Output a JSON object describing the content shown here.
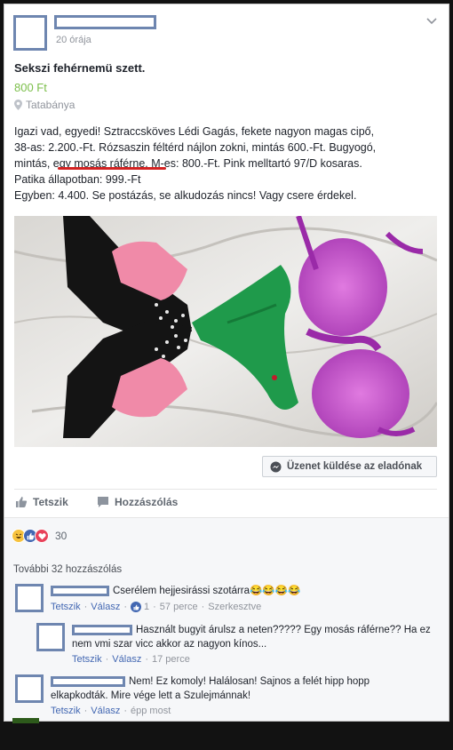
{
  "post": {
    "time": "20 órája",
    "title": "Sekszi fehérnemü szett.",
    "price": "800 Ft",
    "location": "Tatabánya",
    "location_icon": "location-pin-icon",
    "body_lines": [
      "Igazi vad, egyedi! Sztraccsköves Lédi Gagás, fekete nagyon magas cipő,",
      "38-as: 2.200.-Ft. Rózsaszin féltérd nájlon zokni, mintás 600.-Ft. Bugyogó,",
      "mintás, egy mosás ráférne. M-es: 800.-Ft. Pink melltartó 97/D kosaras.",
      "Patika állapotban: 999.-Ft",
      "Egyben: 4.400. Se postázás, se alkudozás nincs! Vagy csere érdekel."
    ],
    "message_button": "Üzenet küldése az eladónak"
  },
  "actions": {
    "like": "Tetszik",
    "comment": "Hozzászólás"
  },
  "reactions": {
    "count": "30",
    "icons": [
      "haha-icon",
      "like-icon",
      "love-icon"
    ]
  },
  "comments_section": {
    "more": "További 32 hozzászólás",
    "items": [
      {
        "text": "Cserélem hejjesirássi szotárra😂😂😂😂",
        "like": "Tetszik",
        "reply": "Válasz",
        "likes": "1",
        "time": "57 perce",
        "edited": "Szerkesztve"
      },
      {
        "text_line1": "Használt bugyit árulsz a neten????? Egy mosás ráférne?? Ha ez",
        "text_line2": "nem vmi szar vicc akkor az nagyon kínos...",
        "like": "Tetszik",
        "reply": "Válasz",
        "time": "17 perce"
      },
      {
        "text_line1": "Nem! Ez komoly! Halálosan! Sajnos a felét hipp hopp",
        "text_line2": "elkapkodták. Mire vége lett a Szulejmánnak!",
        "like": "Tetszik",
        "reply": "Válasz",
        "time": "épp most"
      }
    ]
  },
  "colors": {
    "accent": "#4267b2",
    "price": "#7cbf4b",
    "redact": "#6e86b0",
    "underline": "#d32222"
  }
}
